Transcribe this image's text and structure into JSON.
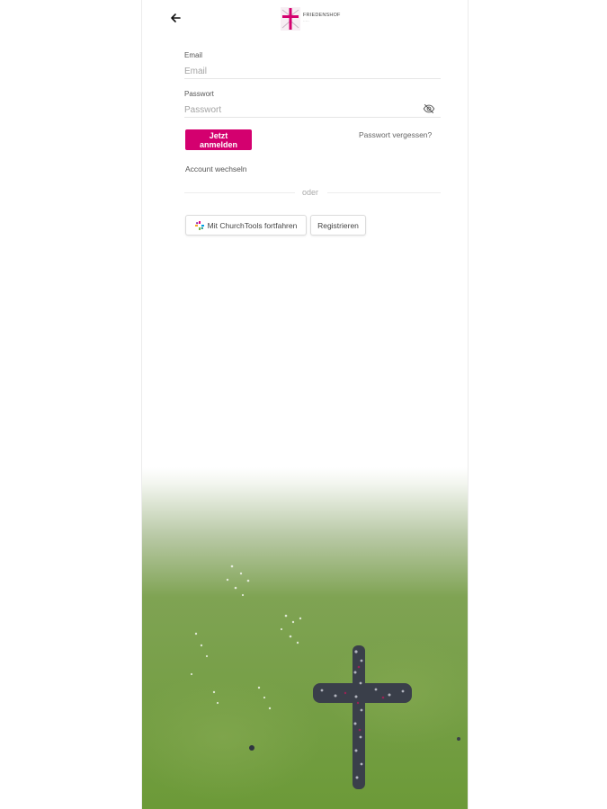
{
  "header": {
    "back_icon": "arrow-left-icon",
    "logo_text": "FRIEDENSHOF",
    "logo_sub": "·····",
    "brand_color": "#d4006f"
  },
  "form": {
    "email_label": "Email",
    "email_placeholder": "Email",
    "password_label": "Passwort",
    "password_placeholder": "Passwort",
    "password_toggle_icon": "eye-off-icon",
    "login_label": "Jetzt anmelden",
    "forgot_label": "Passwort vergessen?",
    "switch_account_label": "Account wechseln",
    "divider_label": "oder"
  },
  "alternatives": {
    "churchtools_label": "Mit ChurchTools fortfahren",
    "churchtools_icon": "churchtools-icon",
    "register_label": "Registrieren"
  },
  "background": {
    "description_icon": "human-cross-photo",
    "grass_color": "#6f9a3e"
  }
}
